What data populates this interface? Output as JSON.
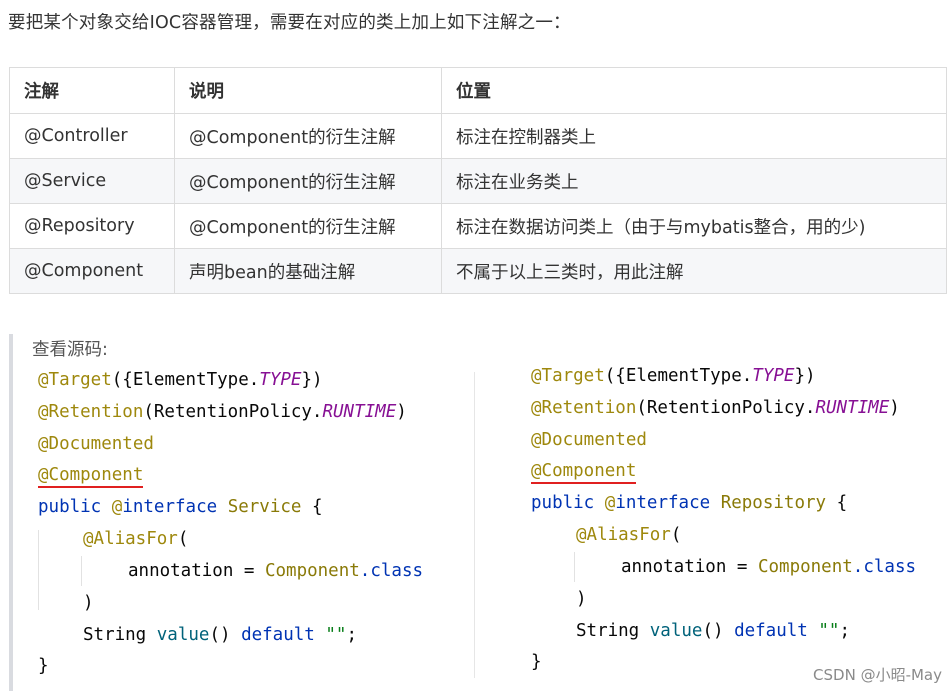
{
  "intro": "要把某个对象交给IOC容器管理，需要在对应的类上加上如下注解之一：",
  "table": {
    "headers": [
      "注解",
      "说明",
      "位置"
    ],
    "rows": [
      [
        "@Controller",
        "@Component的衍生注解",
        "标注在控制器类上"
      ],
      [
        "@Service",
        "@Component的衍生注解",
        "标注在业务类上"
      ],
      [
        "@Repository",
        "@Component的衍生注解",
        "标注在数据访问类上（由于与mybatis整合，用的少)"
      ],
      [
        "@Component",
        "声明bean的基础注解",
        "不属于以上三类时，用此注解"
      ]
    ]
  },
  "source_label": "查看源码:",
  "code_left": {
    "target": "@Target",
    "target_open": "({ElementType.",
    "target_val": "TYPE",
    "target_close": "})",
    "retention": "@Retention",
    "retention_open": "(RetentionPolicy.",
    "retention_val": "RUNTIME",
    "retention_close": ")",
    "documented": "@Documented",
    "component": "@Component",
    "public_kw": "public",
    "at_sign": "@",
    "interface_kw": "interface",
    "name": "Service",
    "brace_open": "{",
    "aliasfor": "@AliasFor",
    "paren_open": "(",
    "annotation_attr": "annotation = ",
    "component_cls": "Component",
    "dot_class": ".class",
    "paren_close": ")",
    "string_type": "String",
    "value_fn": "value",
    "value_parens": "()",
    "default_kw": "default",
    "empty_str": "\"\"",
    "semicolon": ";",
    "brace_close": "}"
  },
  "code_right": {
    "target": "@Target",
    "target_open": "({ElementType.",
    "target_val": "TYPE",
    "target_close": "})",
    "retention": "@Retention",
    "retention_open": "(RetentionPolicy.",
    "retention_val": "RUNTIME",
    "retention_close": ")",
    "documented": "@Documented",
    "component": "@Component",
    "public_kw": "public",
    "at_sign": "@",
    "interface_kw": "interface",
    "name": "Repository",
    "brace_open": "{",
    "aliasfor": "@AliasFor",
    "paren_open": "(",
    "annotation_attr": "annotation = ",
    "component_cls": "Component",
    "dot_class": ".class",
    "paren_close": ")",
    "string_type": "String",
    "value_fn": "value",
    "value_parens": "()",
    "default_kw": "default",
    "empty_str": "\"\"",
    "semicolon": ";",
    "brace_close": "}"
  },
  "watermark": "CSDN @小昭-May",
  "colors": {
    "annotation": "#9e880d",
    "keyword": "#0033b3",
    "italic_constant": "#871094",
    "underline": "#e02020"
  }
}
